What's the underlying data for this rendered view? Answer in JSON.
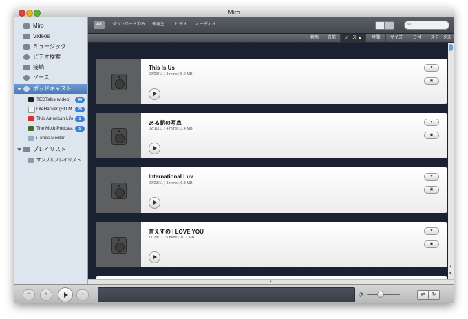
{
  "window": {
    "title": "Miro"
  },
  "sidebar": {
    "items": [
      {
        "label": "Miro",
        "icon": "miro-icon"
      },
      {
        "label": "Videos",
        "icon": "videos-icon"
      },
      {
        "label": "ミュージック",
        "icon": "music-icon"
      },
      {
        "label": "ビデオ検索",
        "icon": "video-search-icon"
      },
      {
        "label": "接続",
        "icon": "connect-icon"
      },
      {
        "label": "ソース",
        "icon": "sources-icon"
      }
    ],
    "podcasts": {
      "label": "ポッドキャスト",
      "feeds": [
        {
          "label": "TEDTalks (video)",
          "badge": "96",
          "icon": "tedtalks-icon"
        },
        {
          "label": "LifeHacker (HD M...",
          "badge": "25",
          "icon": "lifehacker-icon"
        },
        {
          "label": "This American Life",
          "badge": "1",
          "icon": "this-american-life-icon"
        },
        {
          "label": "The Moth Podcast",
          "badge": "5",
          "icon": "moth-podcast-icon"
        },
        {
          "label": "iTunes Media/",
          "badge": "",
          "icon": "itunes-folder-icon"
        }
      ]
    },
    "playlists": {
      "label": "プレイリスト",
      "items": [
        {
          "label": "サンプルプレイリスト",
          "icon": "playlist-icon"
        }
      ]
    }
  },
  "filters": [
    "All",
    "ダウンロード済み",
    "未再生",
    "ビデオ",
    "オーディオ"
  ],
  "sort_columns": [
    "状態",
    "名前",
    "ソース ▲",
    "時間",
    "サイズ",
    "日付",
    "ステータス"
  ],
  "items": [
    {
      "title": "This Is Us",
      "date": "02/23/11",
      "duration": "3 mins",
      "size": "5.9 MB"
    },
    {
      "title": "ある朝の写真",
      "date": "02/10/11",
      "duration": "4 mins",
      "size": "3.4 MB"
    },
    {
      "title": "International Luv",
      "date": "02/23/11",
      "duration": "3 mins",
      "size": "6.3 MB"
    },
    {
      "title": "言えずの I LOVE YOU",
      "date": "11/28/11",
      "duration": "5 mins",
      "size": "10.1 MB"
    }
  ],
  "icons": {
    "search": "search-icon",
    "play": "play-icon",
    "shuffle": "shuffle-icon",
    "repeat": "repeat-icon"
  },
  "colors": {
    "selection": "#4c79b7",
    "badge": "#3b7fd8",
    "list_bg": "#1a2231"
  }
}
